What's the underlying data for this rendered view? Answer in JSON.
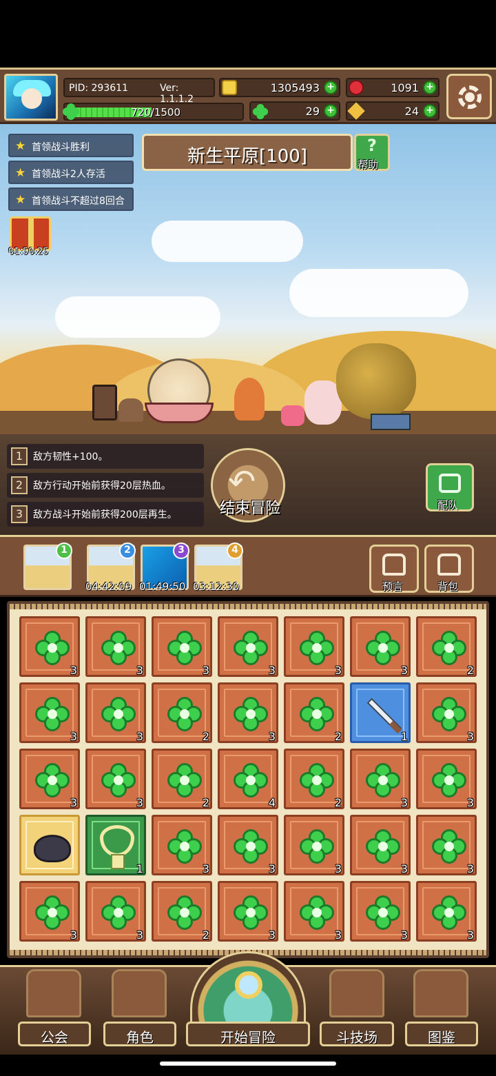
{
  "header": {
    "pid": "PID: 293611",
    "version": "Ver: 1.1.1.2",
    "xp": "720/1500",
    "xp_progress": 0.48,
    "gold": "1305493",
    "gems": "1091",
    "clovers": "29",
    "keys": "24"
  },
  "quests": [
    "首领战斗胜利",
    "首领战斗2人存活",
    "首领战斗不超过8回合"
  ],
  "gift_timer": "01:50:25",
  "stage": {
    "title": "新生平原[100]",
    "help_label": "帮助"
  },
  "modifiers": [
    {
      "num": "1",
      "text": "敌方韧性+100。"
    },
    {
      "num": "2",
      "text": "敌方行动开始前获得20层热血。"
    },
    {
      "num": "3",
      "text": "敌方战斗开始前获得200层再生。"
    }
  ],
  "end_button": "结束冒险",
  "team_button": "配队",
  "map_slots": [
    {
      "badge": "1",
      "timer": ""
    },
    {
      "badge": "2",
      "timer": "04:42:09"
    },
    {
      "badge": "3",
      "timer": "01:49:50"
    },
    {
      "badge": "4",
      "timer": "03:12:30"
    }
  ],
  "side_buttons": {
    "prophecy": "预言",
    "backpack": "背包"
  },
  "inventory": [
    [
      "clover",
      "3"
    ],
    [
      "clover",
      "3"
    ],
    [
      "clover",
      "3"
    ],
    [
      "clover",
      "3"
    ],
    [
      "clover",
      "3"
    ],
    [
      "clover",
      "3"
    ],
    [
      "clover",
      "2"
    ],
    [
      "clover",
      "3"
    ],
    [
      "clover",
      "3"
    ],
    [
      "clover",
      "2"
    ],
    [
      "clover",
      "3"
    ],
    [
      "clover",
      "2"
    ],
    [
      "sword",
      "1"
    ],
    [
      "clover",
      "3"
    ],
    [
      "clover",
      "3"
    ],
    [
      "clover",
      "3"
    ],
    [
      "clover",
      "2"
    ],
    [
      "clover",
      "4"
    ],
    [
      "clover",
      "2"
    ],
    [
      "clover",
      "3"
    ],
    [
      "clover",
      "3"
    ],
    [
      "pot",
      ""
    ],
    [
      "necklace",
      "1"
    ],
    [
      "clover",
      "3"
    ],
    [
      "clover",
      "3"
    ],
    [
      "clover",
      "3"
    ],
    [
      "clover",
      "3"
    ],
    [
      "clover",
      "3"
    ],
    [
      "clover",
      "3"
    ],
    [
      "clover",
      "3"
    ],
    [
      "clover",
      "2"
    ],
    [
      "clover",
      "3"
    ],
    [
      "clover",
      "3"
    ],
    [
      "clover",
      "3"
    ],
    [
      "clover",
      "3"
    ]
  ],
  "nav": {
    "guild": "公会",
    "character": "角色",
    "start": "开始冒险",
    "arena": "斗技场",
    "codex": "图鉴"
  },
  "colors": {
    "accent_gold": "#e4cf97",
    "clover_green": "#3ed04d",
    "tile_orange": "#cf7046"
  }
}
